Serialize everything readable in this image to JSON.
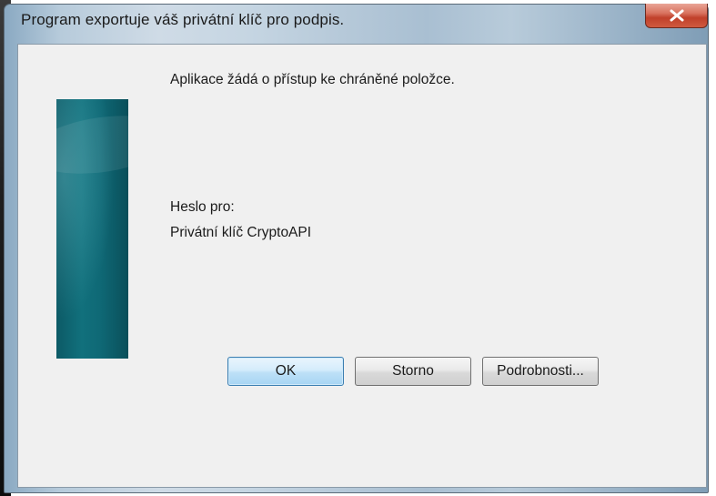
{
  "window": {
    "title": "Program exportuje váš privátní klíč pro podpis."
  },
  "dialog": {
    "message": "Aplikace žádá o přístup ke chráněné položce.",
    "password_for_label": "Heslo pro:",
    "item_name": "Privátní klíč CryptoAPI"
  },
  "buttons": {
    "ok_label": "OK",
    "cancel_label": "Storno",
    "details_label": "Podrobnosti..."
  },
  "icons": {
    "close": "close-icon"
  },
  "colors": {
    "close_button": "#c94a33",
    "banner": "#0f6976",
    "client_background": "#f0f0f0",
    "default_button_border": "#3c7fb1"
  }
}
